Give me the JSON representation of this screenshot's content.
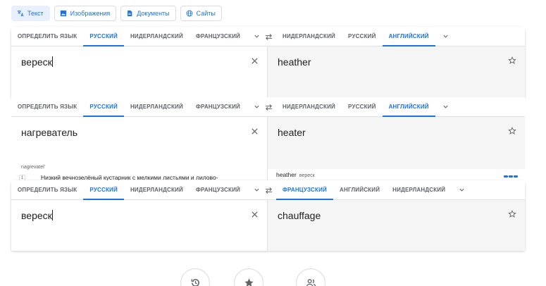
{
  "modes": [
    {
      "label": "Текст",
      "icon": "translate-icon"
    },
    {
      "label": "Изображения",
      "icon": "image-icon"
    },
    {
      "label": "Документы",
      "icon": "document-icon"
    },
    {
      "label": "Сайты",
      "icon": "globe-icon"
    }
  ],
  "panels": [
    {
      "source_langs": [
        "ОПРЕДЕЛИТЬ ЯЗЫК",
        "РУССКИЙ",
        "НИДЕРЛАНДСКИЙ",
        "ФРАНЦУЗСКИЙ"
      ],
      "target_langs": [
        "НИДЕРЛАНДСКИЙ",
        "РУССКИЙ",
        "АНГЛИЙСКИЙ"
      ],
      "source_text": "вереск",
      "target_text": "heather"
    },
    {
      "source_langs": [
        "ОПРЕДЕЛИТЬ ЯЗЫК",
        "РУССКИЙ",
        "НИДЕРЛАНДСКИЙ",
        "ФРАНЦУЗСКИЙ"
      ],
      "target_langs": [
        "НИДЕРЛАНДСКИЙ",
        "РУССКИЙ",
        "АНГЛИЙСКИЙ"
      ],
      "source_text": "нагреватель",
      "target_text": "heater",
      "transliteration": "nagrevatel'",
      "definition_number": "1",
      "definition": "Низкий вечнозелёный кустарник с мелкими листьями и лилово-",
      "alt_translation": "heather",
      "alt_source": "вереск"
    },
    {
      "source_langs": [
        "ОПРЕДЕЛИТЬ ЯЗЫК",
        "РУССКИЙ",
        "НИДЕРЛАНДСКИЙ",
        "ФРАНЦУЗСКИЙ"
      ],
      "target_langs": [
        "ФРАНЦУЗСКИЙ",
        "АНГЛИЙСКИЙ",
        "НИДЕРЛАНДСКИЙ"
      ],
      "source_text": "вереск",
      "target_text": "chauffage"
    }
  ],
  "colors": {
    "accent": "#1a73e8",
    "target_bg": "#f5f5f5",
    "border": "#e0e0e0"
  },
  "bottom_buttons": [
    "history-icon",
    "saved-star-icon",
    "community-icon"
  ]
}
